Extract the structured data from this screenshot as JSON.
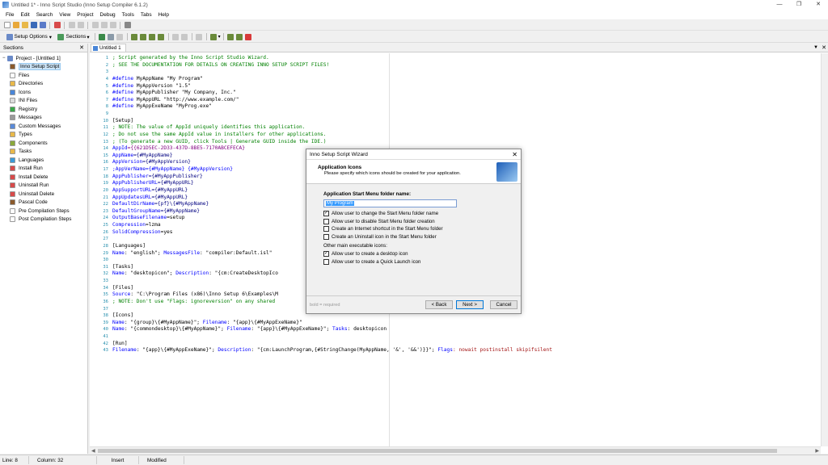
{
  "window": {
    "title": "Untitled 1* - Inno Script Studio (Inno Setup Compiler 6.1.2)",
    "min": "—",
    "max": "❐",
    "close": "✕"
  },
  "menu": [
    "File",
    "Edit",
    "Search",
    "View",
    "Project",
    "Debug",
    "Tools",
    "Tabs",
    "Help"
  ],
  "toolbar2": {
    "setup_options": "Setup Options",
    "sections": "Sections"
  },
  "sections_panel": {
    "title": "Sections",
    "close": "✕",
    "root": "Project - [Untitled 1]",
    "items": [
      {
        "label": "Inno Setup Script",
        "icon": "script-icon",
        "color": "#8b5a2b"
      },
      {
        "label": "Files",
        "icon": "file-icon",
        "color": "#ffffff"
      },
      {
        "label": "Directories",
        "icon": "folder-icon",
        "color": "#e8b84a"
      },
      {
        "label": "Icons",
        "icon": "icons-icon",
        "color": "#4a86d8"
      },
      {
        "label": "INI Files",
        "icon": "ini-icon",
        "color": "#dcdcdc"
      },
      {
        "label": "Registry",
        "icon": "registry-icon",
        "color": "#3aa84a"
      },
      {
        "label": "Messages",
        "icon": "messages-icon",
        "color": "#9a9a9a"
      },
      {
        "label": "Custom Messages",
        "icon": "custom-messages-icon",
        "color": "#5a8ad8"
      },
      {
        "label": "Types",
        "icon": "types-icon",
        "color": "#e8b84a"
      },
      {
        "label": "Components",
        "icon": "components-icon",
        "color": "#8aa83a"
      },
      {
        "label": "Tasks",
        "icon": "tasks-icon",
        "color": "#e8b84a"
      },
      {
        "label": "Languages",
        "icon": "languages-icon",
        "color": "#3a9ad8"
      },
      {
        "label": "Install Run",
        "icon": "install-run-icon",
        "color": "#d84a4a"
      },
      {
        "label": "Install Delete",
        "icon": "install-delete-icon",
        "color": "#d84a4a"
      },
      {
        "label": "Uninstall Run",
        "icon": "uninstall-run-icon",
        "color": "#d84a4a"
      },
      {
        "label": "Uninstall Delete",
        "icon": "uninstall-delete-icon",
        "color": "#d84a4a"
      },
      {
        "label": "Pascal Code",
        "icon": "pascal-code-icon",
        "color": "#8b5a2b"
      },
      {
        "label": "Pre Compilation Steps",
        "icon": "pre-compile-icon",
        "color": "#ffffff"
      },
      {
        "label": "Post Compilation Steps",
        "icon": "post-compile-icon",
        "color": "#ffffff"
      }
    ]
  },
  "editor": {
    "tab": "Untitled 1",
    "lines": [
      [
        {
          "t": "; Script generated by the Inno Script Studio Wizard.",
          "c": "c-green"
        }
      ],
      [
        {
          "t": "; SEE THE DOCUMENTATION FOR DETAILS ON CREATING INNO SETUP SCRIPT FILES!",
          "c": "c-green"
        }
      ],
      [],
      [
        {
          "t": "#define ",
          "c": "c-blue"
        },
        {
          "t": "MyAppName \"My Program\"",
          "c": ""
        }
      ],
      [
        {
          "t": "#define ",
          "c": "c-blue"
        },
        {
          "t": "MyAppVersion \"1.5\"",
          "c": ""
        }
      ],
      [
        {
          "t": "#define ",
          "c": "c-blue"
        },
        {
          "t": "MyAppPublisher \"My Company, Inc.\"",
          "c": ""
        }
      ],
      [
        {
          "t": "#define ",
          "c": "c-blue"
        },
        {
          "t": "MyAppURL \"http://www.example.com/\"",
          "c": ""
        }
      ],
      [
        {
          "t": "#define ",
          "c": "c-blue"
        },
        {
          "t": "MyAppExeName \"MyProg.exe\"",
          "c": ""
        }
      ],
      [],
      [
        {
          "t": "[Setup]",
          "c": ""
        }
      ],
      [
        {
          "t": "; NOTE: The value of AppId uniquely identifies this application.",
          "c": "c-green"
        }
      ],
      [
        {
          "t": "; Do not use the same AppId value in installers for other applications.",
          "c": "c-green"
        }
      ],
      [
        {
          "t": "; (To generate a new GUID, click Tools | Generate GUID inside the IDE.)",
          "c": "c-green"
        }
      ],
      [
        {
          "t": "AppId",
          "c": "c-blue"
        },
        {
          "t": "={{621D5EC-2D33-437D-8BE5-7170ABCEFECA}",
          "c": "c-purple"
        }
      ],
      [
        {
          "t": "AppName",
          "c": "c-blue"
        },
        {
          "t": "={#MyAppName}",
          "c": "c-navy"
        }
      ],
      [
        {
          "t": "AppVersion",
          "c": "c-blue"
        },
        {
          "t": "={#MyAppVersion}",
          "c": "c-navy"
        }
      ],
      [
        {
          "t": ";AppVerName={#MyAppName} {#MyAppVersion}",
          "c": "c-blue"
        }
      ],
      [
        {
          "t": "AppPublisher",
          "c": "c-blue"
        },
        {
          "t": "={#MyAppPublisher}",
          "c": "c-navy"
        }
      ],
      [
        {
          "t": "AppPublisherURL",
          "c": "c-blue"
        },
        {
          "t": "={#MyAppURL}",
          "c": "c-navy"
        }
      ],
      [
        {
          "t": "AppSupportURL",
          "c": "c-blue"
        },
        {
          "t": "={#MyAppURL}",
          "c": "c-navy"
        }
      ],
      [
        {
          "t": "AppUpdatesURL",
          "c": "c-blue"
        },
        {
          "t": "={#MyAppURL}",
          "c": "c-navy"
        }
      ],
      [
        {
          "t": "DefaultDirName",
          "c": "c-blue"
        },
        {
          "t": "={pf}\\{#MyAppName}",
          "c": "c-navy"
        }
      ],
      [
        {
          "t": "DefaultGroupName",
          "c": "c-blue"
        },
        {
          "t": "={#MyAppName}",
          "c": "c-navy"
        }
      ],
      [
        {
          "t": "OutputBaseFilename",
          "c": "c-blue"
        },
        {
          "t": "=setup",
          "c": ""
        }
      ],
      [
        {
          "t": "Compression",
          "c": "c-blue"
        },
        {
          "t": "=lzma",
          "c": ""
        }
      ],
      [
        {
          "t": "SolidCompression",
          "c": "c-blue"
        },
        {
          "t": "=yes",
          "c": ""
        }
      ],
      [],
      [
        {
          "t": "[Languages]",
          "c": ""
        }
      ],
      [
        {
          "t": "Name",
          "c": "c-blue"
        },
        {
          "t": ": \"english\"; ",
          "c": ""
        },
        {
          "t": "MessagesFile",
          "c": "c-blue"
        },
        {
          "t": ": \"compiler:Default.isl\"",
          "c": ""
        }
      ],
      [],
      [
        {
          "t": "[Tasks]",
          "c": ""
        }
      ],
      [
        {
          "t": "Name",
          "c": "c-blue"
        },
        {
          "t": ": \"desktopicon\"; ",
          "c": ""
        },
        {
          "t": "Description",
          "c": "c-blue"
        },
        {
          "t": ": \"{cm:CreateDesktopIco",
          "c": ""
        }
      ],
      [],
      [
        {
          "t": "[Files]",
          "c": ""
        }
      ],
      [
        {
          "t": "Source",
          "c": "c-blue"
        },
        {
          "t": ": \"C:\\Program Files (x86)\\Inno Setup 6\\Examples\\M",
          "c": ""
        }
      ],
      [
        {
          "t": "; NOTE: Don't use \"Flags: ignoreversion\" on any shared",
          "c": "c-green"
        }
      ],
      [],
      [
        {
          "t": "[Icons]",
          "c": ""
        }
      ],
      [
        {
          "t": "Name",
          "c": "c-blue"
        },
        {
          "t": ": \"{group}\\{#MyAppName}\"; ",
          "c": ""
        },
        {
          "t": "Filename",
          "c": "c-blue"
        },
        {
          "t": ": \"{app}\\{#MyAppExeName}\"",
          "c": ""
        }
      ],
      [
        {
          "t": "Name",
          "c": "c-blue"
        },
        {
          "t": ": \"{commondesktop}\\{#MyAppName}\"; ",
          "c": ""
        },
        {
          "t": "Filename",
          "c": "c-blue"
        },
        {
          "t": ": \"{app}\\{#MyAppExeName}\"; ",
          "c": ""
        },
        {
          "t": "Tasks",
          "c": "c-blue"
        },
        {
          "t": ": desktopicon",
          "c": ""
        }
      ],
      [],
      [
        {
          "t": "[Run]",
          "c": ""
        }
      ],
      [
        {
          "t": "Filename",
          "c": "c-blue"
        },
        {
          "t": ": \"{app}\\{#MyAppExeName}\"; ",
          "c": ""
        },
        {
          "t": "Description",
          "c": "c-blue"
        },
        {
          "t": ": \"{cm:LaunchProgram,{#StringChange(MyAppName, '&', '&&')}}\"; ",
          "c": ""
        },
        {
          "t": "Flags",
          "c": "c-blue"
        },
        {
          "t": ": nowait postinstall skipifsilent",
          "c": "c-red"
        }
      ]
    ]
  },
  "dialog": {
    "title": "Inno Setup Script Wizard",
    "close": "✕",
    "heading": "Application Icons",
    "subheading": "Please specify which icons should be created for your application.",
    "folder_label": "Application Start Menu folder name:",
    "folder_value": "My Program",
    "options": [
      {
        "label": "Allow user to change the Start Menu folder name",
        "checked": true
      },
      {
        "label": "Allow user to disable Start Menu folder creation",
        "checked": false
      },
      {
        "label": "Create an Internet shortcut in the Start Menu folder",
        "checked": false
      },
      {
        "label": "Create an Uninstall icon in the Start Menu folder",
        "checked": false
      }
    ],
    "other_label": "Other main executable icons:",
    "other_options": [
      {
        "label": "Allow user to create a desktop icon",
        "checked": true
      },
      {
        "label": "Allow user to create a Quick Launch icon",
        "checked": false
      }
    ],
    "hint": "bold = required",
    "back": "< Back",
    "next": "Next >",
    "cancel": "Cancel"
  },
  "status": {
    "line": "Line: 8",
    "column": "Column: 32",
    "mode": "Insert",
    "state": "Modified"
  }
}
